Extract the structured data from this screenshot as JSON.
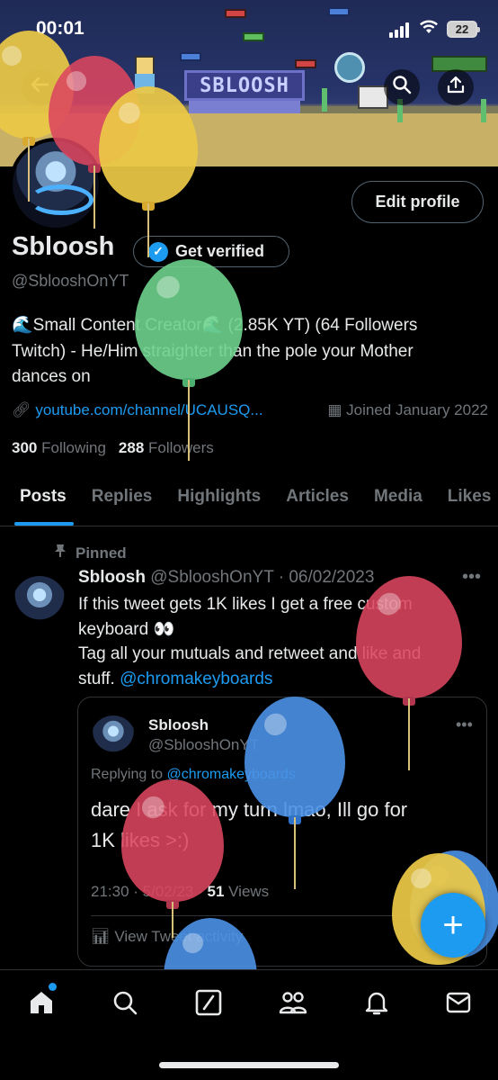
{
  "status_bar": {
    "time": "00:01",
    "battery": "22"
  },
  "banner": {
    "logo_text": "SBLOOSH"
  },
  "header_buttons": {
    "back_icon": "arrow-left-icon",
    "search_icon": "search-icon",
    "share_icon": "share-icon"
  },
  "profile": {
    "display_name": "Sbloosh",
    "get_verified_label": "Get verified",
    "handle": "@SblooshOnYT",
    "edit_profile_label": "Edit profile",
    "bio_line1": "🌊Small Content Creator🌊 (2.85K YT) (64 Followers",
    "bio_line2": "Twitch) - He/Him straighter than the pole your Mother",
    "bio_line3": "dances on",
    "link": "youtube.com/channel/UCAUSQ...",
    "joined": "Joined January 2022",
    "following_count": "300",
    "following_label": "Following",
    "followers_count": "288",
    "followers_label": "Followers"
  },
  "tabs": [
    "Posts",
    "Replies",
    "Highlights",
    "Articles",
    "Media",
    "Likes"
  ],
  "pinned_tweet": {
    "pinned_label": "Pinned",
    "author": "Sbloosh",
    "handle_date": "@SblooshOnYT · 06/02/2023",
    "line1": "If this tweet gets 1K likes I get a free custom",
    "line2": "keyboard 👀",
    "line3": "Tag all your mutuals and retweet and like and",
    "line4_prefix": "stuff. ",
    "mention": "@chromakeyboards",
    "quote": {
      "author": "Sbloosh",
      "handle": "@SblooshOnYT",
      "replying_prefix": "Replying to ",
      "replying_to": "@chromakeyboards",
      "text_line1": "dare I ask for my turn lmao, Ill go for",
      "text_line2": "1K likes >:)",
      "time_prefix": "21:30 · 5/02/23 · ",
      "views_count": "51",
      "views_label": " Views",
      "activity_label": "View Tweet activity"
    }
  },
  "fab_label": "+",
  "bottom_nav": [
    "home-icon",
    "search-icon",
    "grok-icon",
    "communities-icon",
    "notifications-icon",
    "messages-icon"
  ],
  "colors": {
    "accent": "#1d9bf0",
    "background": "#000000",
    "muted": "#71767b"
  }
}
